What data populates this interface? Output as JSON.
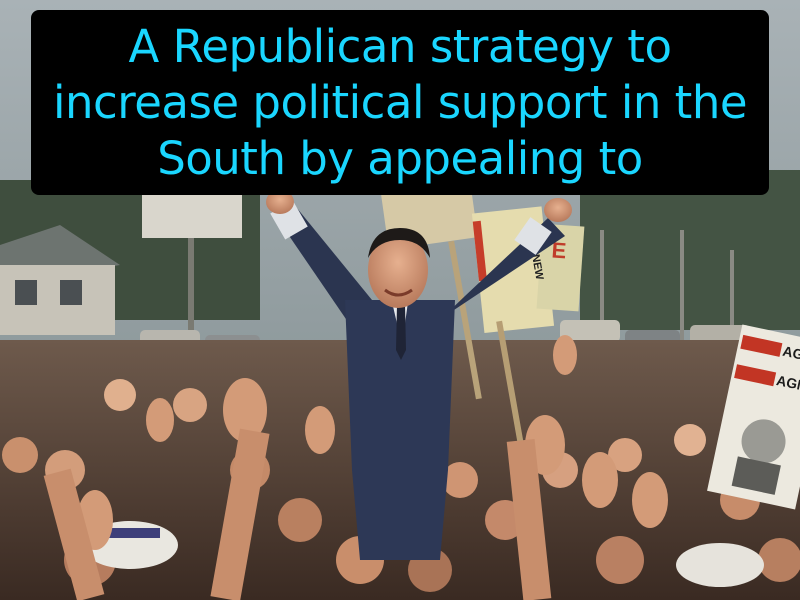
{
  "caption": {
    "text": "A Republican strategy to increase political support in the South by appealing to",
    "text_color": "#1ad6ff",
    "background_color": "#000000"
  },
  "photo": {
    "signs": {
      "nixon_agnew_1": "AGNEW",
      "nixon_agnew_2": "AGNEW",
      "side_sign": "E",
      "pole_sign": "NEW"
    }
  }
}
